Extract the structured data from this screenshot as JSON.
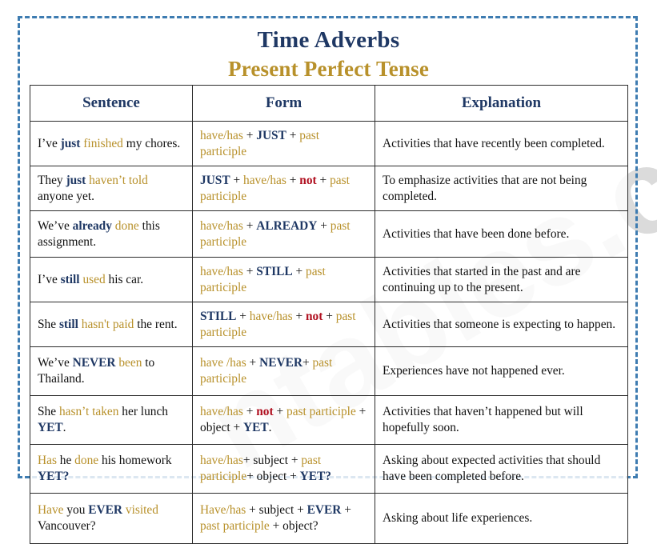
{
  "title": {
    "line1": "Time Adverbs",
    "line2": "Present Perfect Tense",
    "color_main": "#1f3864",
    "color_sub": "#b8912b"
  },
  "watermark": {
    "text": "ntables.com"
  },
  "colors": {
    "navy": "#1f3864",
    "gold": "#b8912b",
    "red": "#b01020",
    "black": "#111111",
    "frame_border": "#3e7cb1",
    "table_border": "#2b2b2b"
  },
  "table": {
    "headers": [
      "Sentence",
      "Form",
      "Explanation"
    ],
    "rows": [
      {
        "sentence_plain": "I’ve just finished my chores.",
        "form_plain": "have/has + JUST + past participle",
        "explanation": "Activities that have recently been completed.",
        "sentence_parts": [
          {
            "t": "I’ve ",
            "c": "blk"
          },
          {
            "t": "just",
            "c": "navy"
          },
          {
            "t": " ",
            "c": "blk"
          },
          {
            "t": "finished",
            "c": "gold"
          },
          {
            "t": " my chores.",
            "c": "blk"
          }
        ],
        "form_parts": [
          {
            "t": "have/has",
            "c": "gold"
          },
          {
            "t": " + ",
            "c": "blk"
          },
          {
            "t": "JUST",
            "c": "navy"
          },
          {
            "t": " + ",
            "c": "blk"
          },
          {
            "t": "past participle",
            "c": "gold"
          }
        ]
      },
      {
        "sentence_plain": "They just haven’t told anyone yet.",
        "form_plain": "JUST + have/has + not + past participle",
        "explanation": "To emphasize activities that are not being completed.",
        "sentence_parts": [
          {
            "t": "They ",
            "c": "blk"
          },
          {
            "t": "just",
            "c": "navy"
          },
          {
            "t": " ",
            "c": "blk"
          },
          {
            "t": "haven’t told",
            "c": "gold"
          },
          {
            "t": " anyone yet.",
            "c": "blk"
          }
        ],
        "form_parts": [
          {
            "t": "JUST",
            "c": "navy"
          },
          {
            "t": " + ",
            "c": "blk"
          },
          {
            "t": "have/has",
            "c": "gold"
          },
          {
            "t": " + ",
            "c": "blk"
          },
          {
            "t": "not",
            "c": "red"
          },
          {
            "t": " + ",
            "c": "blk"
          },
          {
            "t": "past participle",
            "c": "gold"
          }
        ]
      },
      {
        "sentence_plain": "We’ve already done this assignment.",
        "form_plain": "have/has + ALREADY + past participle",
        "explanation": "Activities that have been done before.",
        "sentence_parts": [
          {
            "t": "We’ve ",
            "c": "blk"
          },
          {
            "t": "already",
            "c": "navy"
          },
          {
            "t": " ",
            "c": "blk"
          },
          {
            "t": "done",
            "c": "gold"
          },
          {
            "t": " this assignment.",
            "c": "blk"
          }
        ],
        "form_parts": [
          {
            "t": "have/has",
            "c": "gold"
          },
          {
            "t": " + ",
            "c": "blk"
          },
          {
            "t": "ALREADY",
            "c": "navy"
          },
          {
            "t": " + ",
            "c": "blk"
          },
          {
            "t": "past participle",
            "c": "gold"
          }
        ]
      },
      {
        "sentence_plain": "I’ve still used his car.",
        "form_plain": "have/has + STILL + past participle",
        "explanation": "Activities that started in the past and are continuing up to the present.",
        "sentence_parts": [
          {
            "t": "I’ve ",
            "c": "blk"
          },
          {
            "t": "still",
            "c": "navy"
          },
          {
            "t": " ",
            "c": "blk"
          },
          {
            "t": "used",
            "c": "gold"
          },
          {
            "t": " his car.",
            "c": "blk"
          }
        ],
        "form_parts": [
          {
            "t": "have/has",
            "c": "gold"
          },
          {
            "t": " + ",
            "c": "blk"
          },
          {
            "t": "STILL",
            "c": "navy"
          },
          {
            "t": " + ",
            "c": "blk"
          },
          {
            "t": "past participle",
            "c": "gold"
          }
        ]
      },
      {
        "sentence_plain": "She still hasn't paid the rent.",
        "form_plain": "STILL + have/has + not + past participle",
        "explanation": "Activities that someone is expecting to happen.",
        "sentence_parts": [
          {
            "t": "She ",
            "c": "blk"
          },
          {
            "t": "still",
            "c": "navy"
          },
          {
            "t": " ",
            "c": "blk"
          },
          {
            "t": "hasn't paid",
            "c": "gold"
          },
          {
            "t": " the rent.",
            "c": "blk"
          }
        ],
        "form_parts": [
          {
            "t": "STILL",
            "c": "navy"
          },
          {
            "t": " + ",
            "c": "blk"
          },
          {
            "t": "have/has",
            "c": "gold"
          },
          {
            "t": " + ",
            "c": "blk"
          },
          {
            "t": "not",
            "c": "red"
          },
          {
            "t": " + ",
            "c": "blk"
          },
          {
            "t": "past participle",
            "c": "gold"
          }
        ]
      },
      {
        "sentence_plain": "We’ve NEVER been to Thailand.",
        "form_plain": "have /has + NEVER+ past participle",
        "explanation": "Experiences have not happened ever.",
        "sentence_parts": [
          {
            "t": "We’ve ",
            "c": "blk"
          },
          {
            "t": "NEVER",
            "c": "navy"
          },
          {
            "t": " ",
            "c": "blk"
          },
          {
            "t": "been",
            "c": "gold"
          },
          {
            "t": " to Thailand.",
            "c": "blk"
          }
        ],
        "form_parts": [
          {
            "t": "have /has",
            "c": "gold"
          },
          {
            "t": " + ",
            "c": "blk"
          },
          {
            "t": "NEVER",
            "c": "navy"
          },
          {
            "t": "+ ",
            "c": "blk"
          },
          {
            "t": "past participle",
            "c": "gold"
          }
        ]
      },
      {
        "sentence_plain": "She hasn’t taken her lunch YET.",
        "form_plain": "have/has + not + past participle + object + YET.",
        "explanation": "Activities that haven’t happened but will hopefully soon.",
        "sentence_parts": [
          {
            "t": "She ",
            "c": "blk"
          },
          {
            "t": "hasn’t taken",
            "c": "gold"
          },
          {
            "t": " her lunch ",
            "c": "blk"
          },
          {
            "t": "YET",
            "c": "navy"
          },
          {
            "t": ".",
            "c": "blk"
          }
        ],
        "form_parts": [
          {
            "t": "have/has",
            "c": "gold"
          },
          {
            "t": " + ",
            "c": "blk"
          },
          {
            "t": "not",
            "c": "red"
          },
          {
            "t": " + ",
            "c": "blk"
          },
          {
            "t": "past participle",
            "c": "gold"
          },
          {
            "t": " + object + ",
            "c": "blk"
          },
          {
            "t": "YET",
            "c": "navy"
          },
          {
            "t": ".",
            "c": "blk"
          }
        ]
      },
      {
        "sentence_plain": "Has he done his homework YET?",
        "form_plain": "have/has+ subject + past participle+ object + YET?",
        "explanation": "Asking about expected activities that should have been completed before.",
        "sentence_parts": [
          {
            "t": "Has",
            "c": "gold"
          },
          {
            "t": " he ",
            "c": "blk"
          },
          {
            "t": "done",
            "c": "gold"
          },
          {
            "t": " his homework ",
            "c": "blk"
          },
          {
            "t": "YET?",
            "c": "navy"
          }
        ],
        "form_parts": [
          {
            "t": "have/has",
            "c": "gold"
          },
          {
            "t": "+ subject + ",
            "c": "blk"
          },
          {
            "t": "past participle",
            "c": "gold"
          },
          {
            "t": "+ object + ",
            "c": "blk"
          },
          {
            "t": "YET?",
            "c": "navy"
          }
        ]
      },
      {
        "sentence_plain": "Have you EVER visited Vancouver?",
        "form_plain": "Have/has + subject + EVER + past participle + object?",
        "explanation": "Asking about life experiences.",
        "sentence_parts": [
          {
            "t": "Have",
            "c": "gold"
          },
          {
            "t": " you ",
            "c": "blk"
          },
          {
            "t": "EVER",
            "c": "navy"
          },
          {
            "t": " ",
            "c": "blk"
          },
          {
            "t": "visited",
            "c": "gold"
          },
          {
            "t": " Vancouver?",
            "c": "blk"
          }
        ],
        "form_parts": [
          {
            "t": "Have/has",
            "c": "gold"
          },
          {
            "t": " + subject + ",
            "c": "blk"
          },
          {
            "t": "EVER",
            "c": "navy"
          },
          {
            "t": " + ",
            "c": "blk"
          },
          {
            "t": "past participle",
            "c": "gold"
          },
          {
            "t": " + object?",
            "c": "blk"
          }
        ]
      }
    ]
  }
}
